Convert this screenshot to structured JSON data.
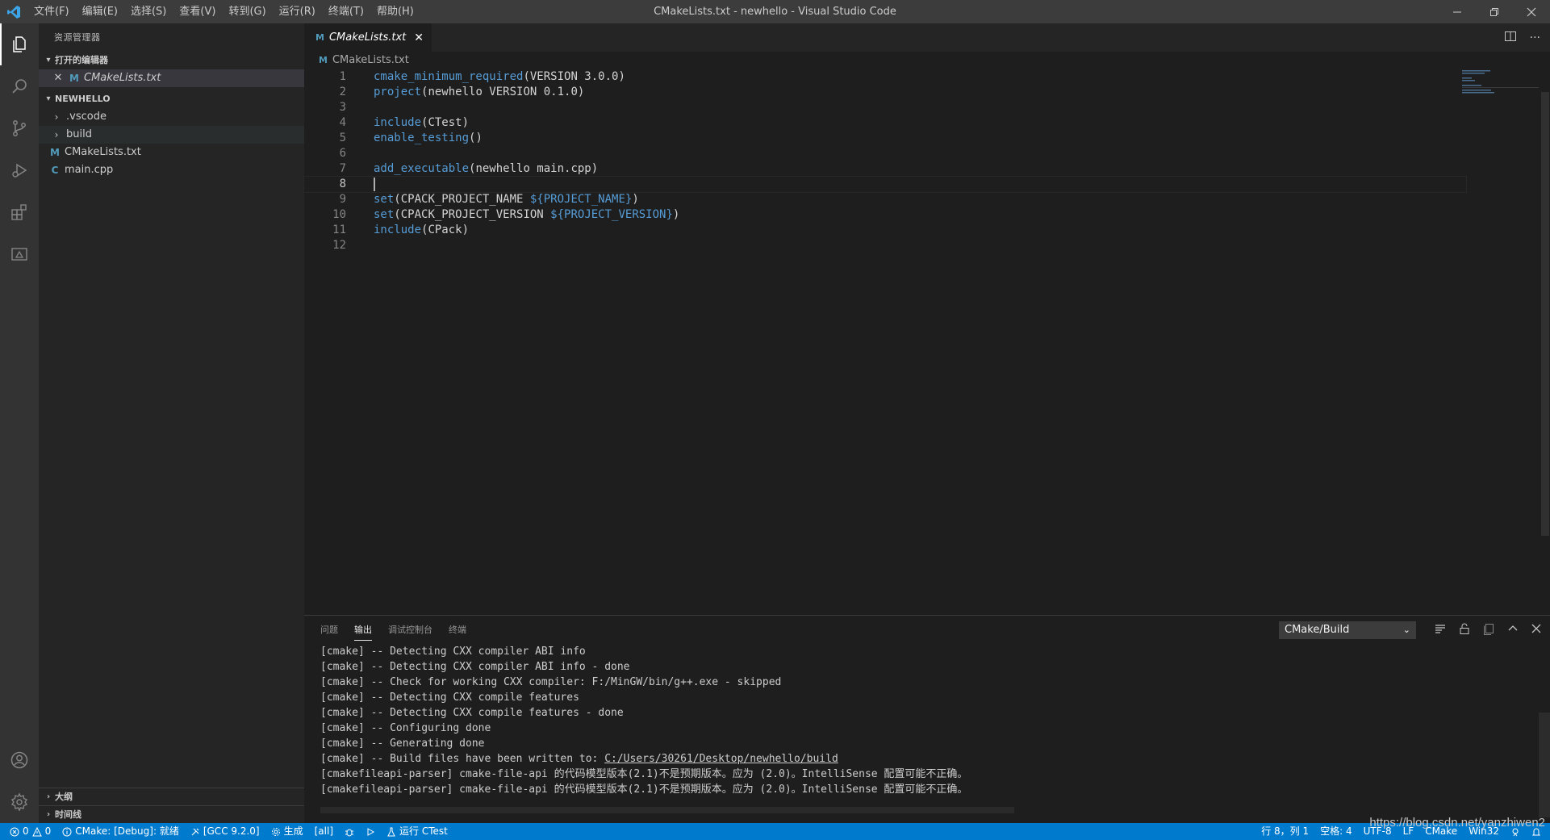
{
  "titlebar": {
    "menus": [
      "文件(F)",
      "编辑(E)",
      "选择(S)",
      "查看(V)",
      "转到(G)",
      "运行(R)",
      "终端(T)",
      "帮助(H)"
    ],
    "title": "CMakeLists.txt - newhello - Visual Studio Code"
  },
  "activity": [
    "files-icon",
    "search-icon",
    "source-control-icon",
    "run-debug-icon",
    "extensions-icon",
    "remote-explorer-icon",
    "account-icon",
    "gear-icon"
  ],
  "sidebar": {
    "title": "资源管理器",
    "open_editors": {
      "header": "打开的编辑器",
      "items": [
        {
          "label": "CMakeLists.txt",
          "icon": "M"
        }
      ]
    },
    "folder": {
      "header": "NEWHELLO",
      "items": [
        {
          "label": ".vscode",
          "kind": "folder"
        },
        {
          "label": "build",
          "kind": "folder"
        },
        {
          "label": "CMakeLists.txt",
          "kind": "file",
          "icon": "M"
        },
        {
          "label": "main.cpp",
          "kind": "file",
          "icon": "C"
        }
      ]
    },
    "outline": "大纲",
    "timeline": "时间线"
  },
  "editor": {
    "tab": {
      "label": "CMakeLists.txt",
      "icon": "M"
    },
    "breadcrumb": "CMakeLists.txt",
    "lines": [
      {
        "n": "1",
        "fn": "cmake_minimum_required",
        "rest": "(VERSION 3.0.0)",
        "var": "",
        "tail": ""
      },
      {
        "n": "2",
        "fn": "project",
        "rest": "(newhello VERSION 0.1.0)",
        "var": "",
        "tail": ""
      },
      {
        "n": "3",
        "fn": "",
        "rest": "",
        "var": "",
        "tail": ""
      },
      {
        "n": "4",
        "fn": "include",
        "rest": "(CTest)",
        "var": "",
        "tail": ""
      },
      {
        "n": "5",
        "fn": "enable_testing",
        "rest": "()",
        "var": "",
        "tail": ""
      },
      {
        "n": "6",
        "fn": "",
        "rest": "",
        "var": "",
        "tail": ""
      },
      {
        "n": "7",
        "fn": "add_executable",
        "rest": "(newhello main.cpp)",
        "var": "",
        "tail": ""
      },
      {
        "n": "8",
        "fn": "",
        "rest": "",
        "var": "",
        "tail": ""
      },
      {
        "n": "9",
        "fn": "set",
        "rest": "(CPACK_PROJECT_NAME ",
        "var": "${PROJECT_NAME}",
        "tail": ")"
      },
      {
        "n": "10",
        "fn": "set",
        "rest": "(CPACK_PROJECT_VERSION ",
        "var": "${PROJECT_VERSION}",
        "tail": ")"
      },
      {
        "n": "11",
        "fn": "include",
        "rest": "(CPack)",
        "var": "",
        "tail": ""
      },
      {
        "n": "12",
        "fn": "",
        "rest": "",
        "var": "",
        "tail": ""
      }
    ]
  },
  "panel": {
    "tabs": [
      "问题",
      "输出",
      "调试控制台",
      "终端"
    ],
    "active_tab": "输出",
    "channel": "CMake/Build",
    "output": [
      {
        "text": "[cmake] -- Detecting CXX compiler ABI info",
        "link": "",
        "after": ""
      },
      {
        "text": "[cmake] -- Detecting CXX compiler ABI info - done",
        "link": "",
        "after": ""
      },
      {
        "text": "[cmake] -- Check for working CXX compiler: F:/MinGW/bin/g++.exe - skipped",
        "link": "",
        "after": ""
      },
      {
        "text": "[cmake] -- Detecting CXX compile features",
        "link": "",
        "after": ""
      },
      {
        "text": "[cmake] -- Detecting CXX compile features - done",
        "link": "",
        "after": ""
      },
      {
        "text": "[cmake] -- Configuring done",
        "link": "",
        "after": ""
      },
      {
        "text": "[cmake] -- Generating done",
        "link": "",
        "after": ""
      },
      {
        "text": "[cmake] -- Build files have been written to: ",
        "link": "C:/Users/30261/Desktop/newhello/build",
        "after": ""
      },
      {
        "text": "[cmakefileapi-parser] cmake-file-api 的代码模型版本(2.1)不是预期版本。应为 (2.0)。IntelliSense 配置可能不正确。",
        "link": "",
        "after": ""
      },
      {
        "text": "[cmakefileapi-parser] cmake-file-api 的代码模型版本(2.1)不是预期版本。应为 (2.0)。IntelliSense 配置可能不正确。",
        "link": "",
        "after": ""
      }
    ]
  },
  "statusbar": {
    "errors": "0",
    "warnings": "0",
    "cmake_status": "CMake: [Debug]: 就绪",
    "kit": "[GCC 9.2.0]",
    "build": "生成",
    "target": "[all]",
    "ctest": "运行 CTest",
    "position": "行 8，列 1",
    "spaces": "空格: 4",
    "encoding": "UTF-8",
    "eol": "LF",
    "language": "CMake",
    "platform": "Win32"
  },
  "watermark": "https://blog.csdn.net/yanzhiwen2",
  "colors": {
    "accent": "#007acc",
    "keyword": "#569cd6",
    "background": "#1e1e1e"
  }
}
